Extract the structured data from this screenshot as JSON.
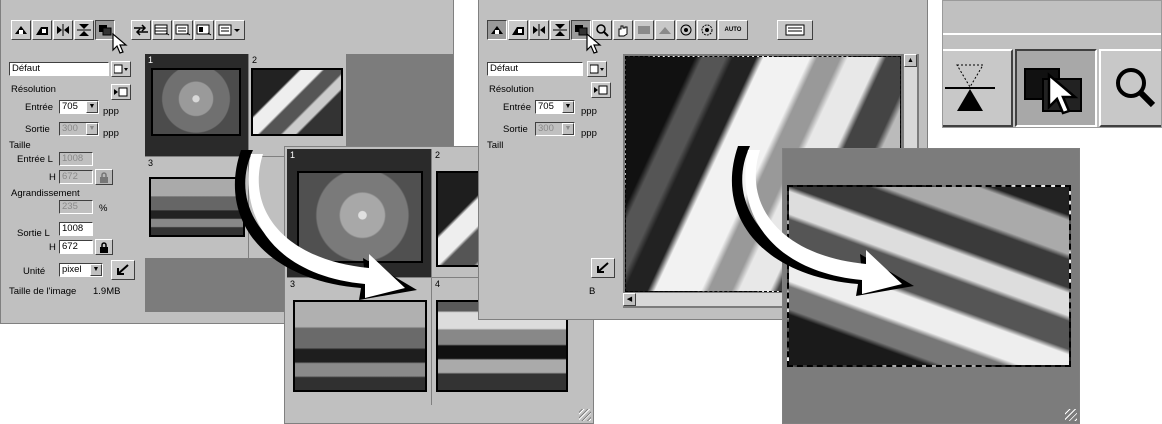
{
  "panel": {
    "preset": "Défaut",
    "resolution_label": "Résolution",
    "input_label": "Entrée",
    "input_value": "705",
    "unit_ppp": "ppp",
    "output_label": "Sortie",
    "output_value": "300",
    "size_label": "Taille",
    "input_w_label": "Entrée L",
    "input_w_value": "1008",
    "h_label": "H",
    "input_h_value": "672",
    "enlarge_label": "Agrandissement",
    "enlarge_value": "235",
    "percent": "%",
    "output_w_label": "Sortie L",
    "output_w_value": "1008",
    "output_h_value": "672",
    "unit_label": "Unité",
    "unit_value": "pixel",
    "image_size_label": "Taille de l'image",
    "image_size_value": "1.9MB",
    "image_size_value_cut": "B",
    "size_label_cut": "Taill"
  },
  "thumbs": {
    "t1": "1",
    "t2": "2",
    "t3": "3",
    "t4": "4"
  },
  "toolbar2": {
    "auto_label": "AUTO"
  },
  "colors": {
    "window_bg": "#c0c0c0",
    "dark_area": "#7c7c7c",
    "selected_thumb": "#2a2a2a"
  }
}
